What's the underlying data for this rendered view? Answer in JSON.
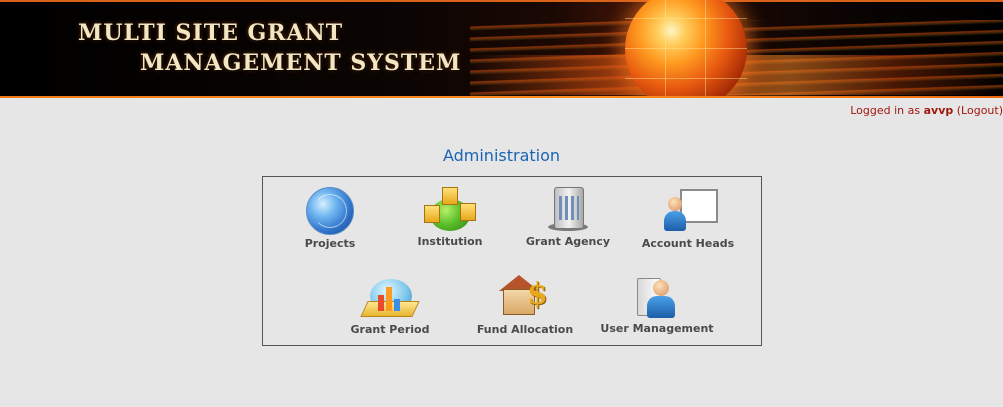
{
  "header": {
    "title_line1": "MULTI SITE GRANT",
    "title_line2": "MANAGEMENT SYSTEM"
  },
  "login": {
    "prefix": "Logged in as ",
    "username": "avvp",
    "logout_label": "(Logout)"
  },
  "admin": {
    "title": "Administration",
    "items": [
      {
        "label": "Projects",
        "icon": "globe-network-icon"
      },
      {
        "label": "Institution",
        "icon": "institution-globe-icon"
      },
      {
        "label": "Grant Agency",
        "icon": "grant-agency-building-icon"
      },
      {
        "label": "Account Heads",
        "icon": "account-heads-person-board-icon"
      },
      {
        "label": "Grant Period",
        "icon": "grant-period-chart-icon"
      },
      {
        "label": "Fund Allocation",
        "icon": "fund-allocation-house-dollar-icon"
      },
      {
        "label": "User Management",
        "icon": "user-management-person-icon"
      }
    ]
  },
  "colors": {
    "accent_orange": "#f07a18",
    "title_blue": "#1a64b4",
    "login_red": "#a0180f",
    "background": "#e6e6e6"
  }
}
